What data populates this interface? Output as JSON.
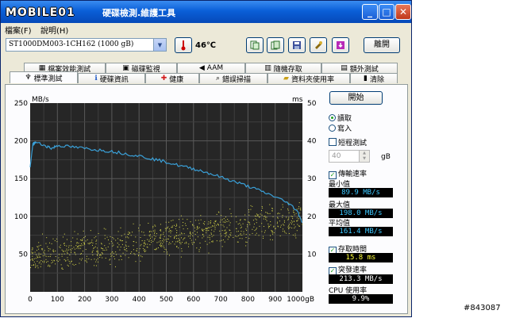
{
  "window": {
    "logo_text": "MOBILE01",
    "title": "硬碟檢測.維護工具",
    "minimize": "_",
    "maximize": "□",
    "close": "✕"
  },
  "menu": [
    "檔案(F)",
    "說明(H)"
  ],
  "toolbar": {
    "drive": "ST1000DM003-1CH162 (1000 gB)",
    "temperature": "46℃",
    "exit": "離開",
    "icons": [
      "copy-text-icon",
      "copy-clipboard-icon",
      "save-icon",
      "options-icon",
      "download-icon"
    ]
  },
  "tabs_top": [
    {
      "label": "檔案效能測試",
      "icon": "file-benchmark-icon"
    },
    {
      "label": "磁碟監視",
      "icon": "disk-monitor-icon"
    },
    {
      "label": "AAM",
      "icon": "speaker-icon"
    },
    {
      "label": "隨機存取",
      "icon": "random-access-icon"
    },
    {
      "label": "額外測試",
      "icon": "extra-tests-icon"
    }
  ],
  "tabs_bottom": [
    {
      "label": "標準測試",
      "icon": "benchmark-icon",
      "active": true
    },
    {
      "label": "硬碟資訊",
      "icon": "info-icon"
    },
    {
      "label": "健康",
      "icon": "health-icon"
    },
    {
      "label": "錯誤掃描",
      "icon": "error-scan-icon"
    },
    {
      "label": "資料夾使用率",
      "icon": "folder-usage-icon"
    },
    {
      "label": "清除",
      "icon": "erase-icon"
    }
  ],
  "controls": {
    "start": "開始",
    "read": "讀取",
    "write": "寫入",
    "short_stroke": "短程測試",
    "spin_value": "40",
    "spin_unit": "gB",
    "transfer_rate": "傳輸速率",
    "min_label": "最小值",
    "min_value": "89.9 MB/s",
    "max_label": "最大值",
    "max_value": "198.0 MB/s",
    "avg_label": "平均值",
    "avg_value": "161.4 MB/s",
    "access_time": "存取時間",
    "access_value": "15.8 ms",
    "burst_rate": "突發速率",
    "burst_value": "213.3 MB/s",
    "cpu_label": "CPU 使用率",
    "cpu_value": "9.9%"
  },
  "chart_data": {
    "type": "line",
    "y_left_label": "MB/s",
    "y_right_label": "ms",
    "x_unit": "gB",
    "x_ticks": [
      "0",
      "100",
      "200",
      "300",
      "400",
      "500",
      "600",
      "700",
      "800",
      "900",
      "1000gB"
    ],
    "y_left_ticks": [
      "250",
      "200",
      "150",
      "100",
      "50"
    ],
    "y_right_ticks": [
      "50",
      "40",
      "30",
      "20",
      "10"
    ],
    "xlim": [
      0,
      1000
    ],
    "ylim_left": [
      0,
      250
    ],
    "ylim_right": [
      0,
      50
    ],
    "transfer_series": {
      "name": "transfer rate",
      "color": "#3aa0d8",
      "x": [
        0,
        10,
        20,
        60,
        80,
        100,
        150,
        200,
        250,
        300,
        350,
        400,
        450,
        500,
        550,
        600,
        650,
        700,
        750,
        800,
        850,
        900,
        950,
        980,
        1000
      ],
      "y": [
        165,
        196,
        198,
        193,
        190,
        194,
        192,
        190,
        188,
        186,
        183,
        180,
        176,
        172,
        167,
        163,
        158,
        152,
        146,
        140,
        133,
        126,
        117,
        108,
        92
      ]
    },
    "access_series": {
      "name": "access time",
      "color": "#d8d84a",
      "x_range": [
        0,
        1000
      ],
      "y_range_ms": [
        6,
        25
      ],
      "center_ms": 15.8
    },
    "grid": true
  },
  "watermark": "#843087"
}
